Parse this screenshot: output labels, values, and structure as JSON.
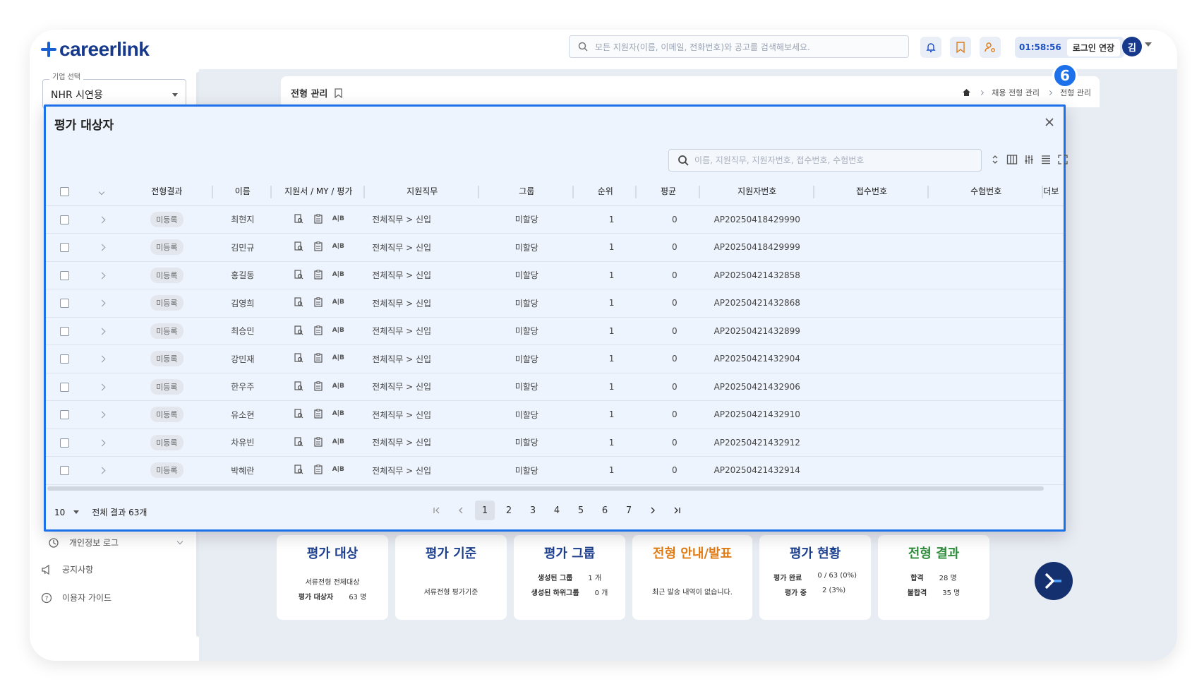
{
  "app": {
    "logo_text": "careerlink",
    "search_placeholder": "모든 지원자(이름, 이메일, 전화번호)와 공고를 검색해보세요.",
    "timer": "01:58:56",
    "extend_login": "로그인 연장",
    "avatar_initial": "김"
  },
  "sidebar": {
    "company_label": "기업 선택",
    "company_value": "NHR 시연용",
    "items": [
      {
        "label": "개인정보 로그"
      },
      {
        "label": "공지사항"
      },
      {
        "label": "이용자 가이드"
      }
    ]
  },
  "page": {
    "title": "전형 관리",
    "breadcrumb": [
      "채용 전형 관리",
      "전형 관리"
    ]
  },
  "cards": [
    {
      "title": "평가 대상",
      "lines": [
        [
          "서류전형 전체대상",
          ""
        ],
        [
          "평가 대상자",
          "63 명"
        ]
      ]
    },
    {
      "title": "평가 기준",
      "lines": [
        [
          "서류전형 평가기준",
          ""
        ]
      ]
    },
    {
      "title": "평가 그룹",
      "lines": [
        [
          "생성된 그룹",
          "1 개"
        ],
        [
          "생성된 하위그룹",
          "0 개"
        ]
      ]
    },
    {
      "title": "전형 안내/발표",
      "lines": [
        [
          "최근 발송 내역이 없습니다.",
          ""
        ]
      ]
    },
    {
      "title": "평가 현황",
      "lines": [
        [
          "평가 완료",
          "0 / 63 (0%)"
        ],
        [
          "평가 중",
          "2 (3%)"
        ]
      ]
    },
    {
      "title": "전형 결과",
      "lines": [
        [
          "합격",
          "28 명"
        ],
        [
          "불합격",
          "35 명"
        ]
      ]
    }
  ],
  "modal": {
    "title": "평가 대상자",
    "step_badge": "6",
    "search_placeholder": "이름, 지원직무, 지원자번호, 접수번호, 수험번호",
    "columns": [
      "전형결과",
      "이름",
      "지원서 / MY / 평가",
      "지원직무",
      "그룹",
      "순위",
      "평균",
      "지원자번호",
      "접수번호",
      "수험번호",
      "더보"
    ],
    "rows": [
      {
        "status": "미등록",
        "name": "최현지",
        "job": "전체직무 > 신입",
        "group": "미할당",
        "rank": "1",
        "avg": "0",
        "applicant_no": "AP20250418429990"
      },
      {
        "status": "미등록",
        "name": "김민규",
        "job": "전체직무 > 신입",
        "group": "미할당",
        "rank": "1",
        "avg": "0",
        "applicant_no": "AP20250418429999"
      },
      {
        "status": "미등록",
        "name": "홍길동",
        "job": "전체직무 > 신입",
        "group": "미할당",
        "rank": "1",
        "avg": "0",
        "applicant_no": "AP20250421432858"
      },
      {
        "status": "미등록",
        "name": "김영희",
        "job": "전체직무 > 신입",
        "group": "미할당",
        "rank": "1",
        "avg": "0",
        "applicant_no": "AP20250421432868"
      },
      {
        "status": "미등록",
        "name": "최승민",
        "job": "전체직무 > 신입",
        "group": "미할당",
        "rank": "1",
        "avg": "0",
        "applicant_no": "AP20250421432899"
      },
      {
        "status": "미등록",
        "name": "강민재",
        "job": "전체직무 > 신입",
        "group": "미할당",
        "rank": "1",
        "avg": "0",
        "applicant_no": "AP20250421432904"
      },
      {
        "status": "미등록",
        "name": "한우주",
        "job": "전체직무 > 신입",
        "group": "미할당",
        "rank": "1",
        "avg": "0",
        "applicant_no": "AP20250421432906"
      },
      {
        "status": "미등록",
        "name": "유소현",
        "job": "전체직무 > 신입",
        "group": "미할당",
        "rank": "1",
        "avg": "0",
        "applicant_no": "AP20250421432910"
      },
      {
        "status": "미등록",
        "name": "차유빈",
        "job": "전체직무 > 신입",
        "group": "미할당",
        "rank": "1",
        "avg": "0",
        "applicant_no": "AP20250421432912"
      },
      {
        "status": "미등록",
        "name": "박혜란",
        "job": "전체직무 > 신입",
        "group": "미할당",
        "rank": "1",
        "avg": "0",
        "applicant_no": "AP20250421432914"
      }
    ],
    "ab_label": "A|B",
    "page_size": "10",
    "total_text": "전체 결과 63개",
    "pages": [
      "1",
      "2",
      "3",
      "4",
      "5",
      "6",
      "7"
    ],
    "current_page": "1"
  },
  "colors": {
    "brand": "#16398c",
    "accent": "#1c70ea",
    "modal_bg": "#eef4fd"
  }
}
